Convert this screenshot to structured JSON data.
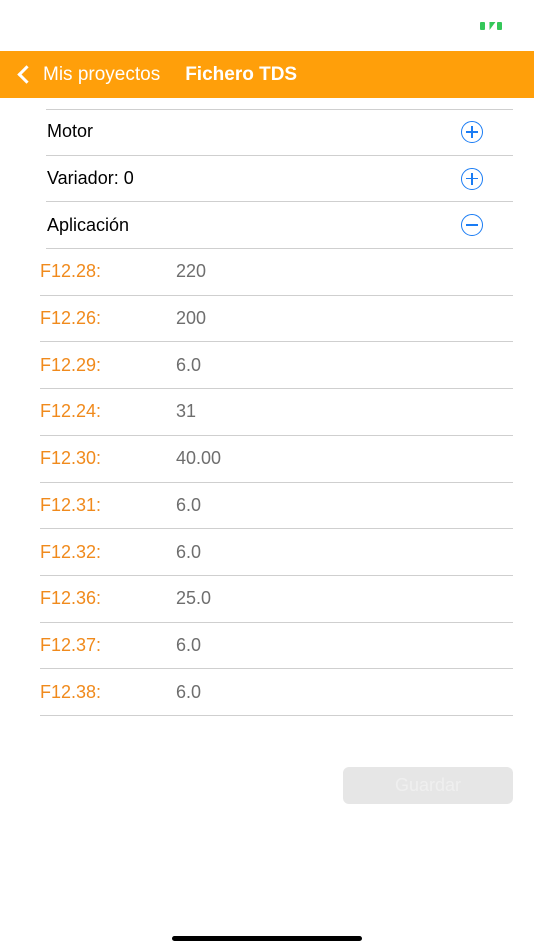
{
  "nav": {
    "back_label": "Mis proyectos",
    "title": "Fichero TDS"
  },
  "sections": [
    {
      "label": "Motor",
      "icon": "plus-circle-icon"
    },
    {
      "label": "Variador: 0",
      "icon": "plus-circle-icon"
    },
    {
      "label": "Aplicación",
      "icon": "minus-circle-icon"
    }
  ],
  "params": [
    {
      "code": "F12.28:",
      "value": "220"
    },
    {
      "code": "F12.26:",
      "value": "200"
    },
    {
      "code": "F12.29:",
      "value": "6.0"
    },
    {
      "code": "F12.24:",
      "value": "31"
    },
    {
      "code": "F12.30:",
      "value": "40.00"
    },
    {
      "code": "F12.31:",
      "value": "6.0"
    },
    {
      "code": "F12.32:",
      "value": "6.0"
    },
    {
      "code": "F12.36:",
      "value": "25.0"
    },
    {
      "code": "F12.37:",
      "value": "6.0"
    },
    {
      "code": "F12.38:",
      "value": "6.0"
    }
  ],
  "save_button": {
    "label": "Guardar",
    "enabled": false
  },
  "colors": {
    "accent": "#ff9f0a",
    "param_code": "#f08a1c",
    "icon_blue": "#1a7cf4",
    "battery_green": "#34c759"
  }
}
